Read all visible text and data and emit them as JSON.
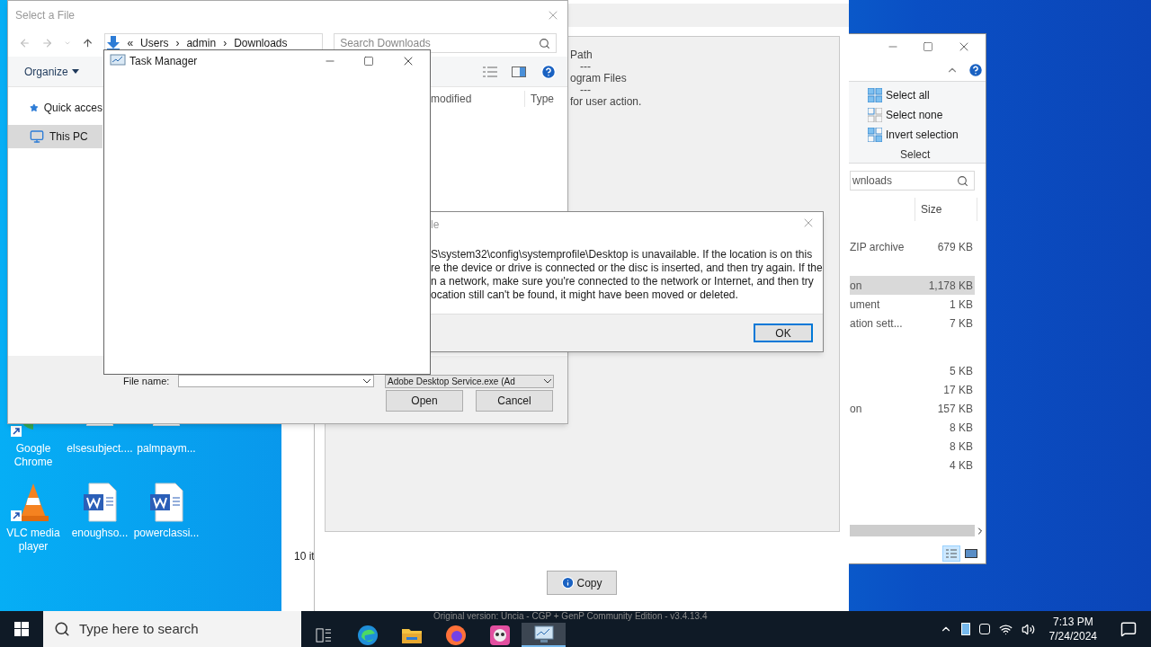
{
  "desktop_icons": [
    {
      "label": "Google\nChrome",
      "kind": "chrome",
      "shortcut": true
    },
    {
      "label": "elsesubject....",
      "kind": "file",
      "shortcut": false
    },
    {
      "label": "palmpaym...",
      "kind": "file",
      "shortcut": false
    },
    {
      "label": "VLC media\nplayer",
      "kind": "vlc",
      "shortcut": true
    },
    {
      "label": "enoughso...",
      "kind": "word",
      "shortcut": false
    },
    {
      "label": "powerclassi...",
      "kind": "word",
      "shortcut": false
    }
  ],
  "back_window": {
    "status": "10 it"
  },
  "genp_window": {
    "lines": [
      "Path",
      "---",
      "ogram Files",
      "---",
      "for user action."
    ],
    "copy_button": "Copy"
  },
  "explorer": {
    "ribbon": [
      "Select all",
      "Select none",
      "Invert selection"
    ],
    "group_label": "Select",
    "search_value": "wnloads",
    "size_header": "Size",
    "rows": [
      {
        "type": "ZIP archive",
        "size": "679 KB",
        "selected": false
      },
      {
        "type": "on",
        "size": "1,178 KB",
        "selected": true
      },
      {
        "type": "ument",
        "size": "1 KB",
        "selected": false
      },
      {
        "type": "ation sett...",
        "size": "7 KB",
        "selected": false
      },
      {
        "type": "",
        "size": "5 KB",
        "selected": false
      },
      {
        "type": "",
        "size": "17 KB",
        "selected": false
      },
      {
        "type": "on",
        "size": "157 KB",
        "selected": false
      },
      {
        "type": "",
        "size": "8 KB",
        "selected": false
      },
      {
        "type": "",
        "size": "8 KB",
        "selected": false
      },
      {
        "type": "",
        "size": "4 KB",
        "selected": false
      }
    ]
  },
  "file_dialog": {
    "title": "Select a File",
    "breadcrumb": [
      "«",
      "Users",
      "›",
      "admin",
      "›",
      "Downloads"
    ],
    "search_placeholder": "Search Downloads",
    "organize": "Organize",
    "nav": [
      {
        "label": "Quick acces",
        "kind": "star",
        "selected": false
      },
      {
        "label": "This PC",
        "kind": "pc",
        "selected": true
      }
    ],
    "columns": [
      "modified",
      "Type"
    ],
    "file_name_label": "File name:",
    "filter": "Adobe Desktop Service.exe (Ad",
    "open": "Open",
    "cancel": "Cancel"
  },
  "error_dialog": {
    "title": "le",
    "lines": [
      "S\\system32\\config\\systemprofile\\Desktop is unavailable. If the location is on this",
      "re the device or drive is connected or the disc is inserted, and then try again. If the",
      "n a network, make sure you're connected to the network or Internet, and then try",
      "ocation still can't be found, it might have been moved or deleted."
    ],
    "ok": "OK"
  },
  "task_manager": {
    "title": "Task Manager"
  },
  "taskbar": {
    "search_placeholder": "Type here to search",
    "overlay_text": "Original version: Uncia - CGP + GenP Community Edition - v3.4.13.4",
    "apps": [
      {
        "kind": "taskview",
        "selected": false
      },
      {
        "kind": "edge",
        "selected": false
      },
      {
        "kind": "explorer",
        "selected": false
      },
      {
        "kind": "firefox",
        "selected": false
      },
      {
        "kind": "paint",
        "selected": false
      },
      {
        "kind": "taskmgr",
        "selected": true
      }
    ],
    "time": "7:13 PM",
    "date": "7/24/2024"
  }
}
